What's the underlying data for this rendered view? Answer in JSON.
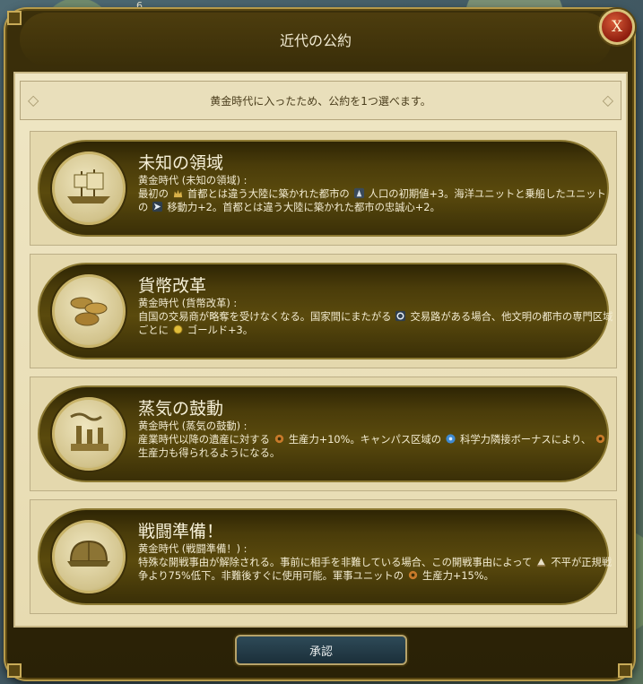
{
  "map": {
    "tile_number": "6"
  },
  "dialog": {
    "title": "近代の公約",
    "close_label": "X",
    "banner": "黄金時代に入ったため、公約を1つ選べます。",
    "accept_label": "承認"
  },
  "cards": [
    {
      "title": "未知の領域",
      "era": "黄金時代 (未知の領域) :",
      "parts": [
        "最初の",
        "首都とは違う大陸に築かれた都市の",
        "人口の初期値+3。海洋ユニットと乗船したユニットの",
        "移動力+2。首都とは違う大陸に築かれた都市の忠誠心+2。"
      ],
      "icons": [
        "capital-icon",
        "citizen-icon",
        "movement-icon"
      ],
      "medal": "ship-icon"
    },
    {
      "title": "貨幣改革",
      "era": "黄金時代 (貨幣改革) :",
      "parts": [
        "自国の交易商が略奪を受けなくなる。国家間にまたがる",
        "交易路がある場合、他文明の都市の専門区域ごとに",
        "ゴールド+3。"
      ],
      "icons": [
        "trade-route-icon",
        "gold-icon"
      ],
      "medal": "coins-icon"
    },
    {
      "title": "蒸気の鼓動",
      "era": "黄金時代 (蒸気の鼓動) :",
      "parts": [
        "産業時代以降の遺産に対する",
        "生産力+10%。キャンパス区域の",
        "科学力隣接ボーナスにより、",
        "生産力も得られるようになる。"
      ],
      "icons": [
        "production-icon",
        "science-icon",
        "production-icon"
      ],
      "medal": "factory-icon"
    },
    {
      "title": "戦闘準備！",
      "era": "黄金時代 (戦闘準備！) :",
      "parts": [
        "特殊な開戦事由が解除される。事前に相手を非難している場合、この開戦事由によって",
        "不平が正規戦争より75%低下。非難後すぐに使用可能。軍事ユニットの",
        "生産力+15%。"
      ],
      "icons": [
        "grievance-icon",
        "production-icon"
      ],
      "medal": "helmet-icon"
    }
  ],
  "colors": {
    "frame": "#3b2f0a",
    "parchment": "#efe6c4",
    "card": "#4a3c0a",
    "gold_trim": "#b69a4a",
    "close_red": "#b8351c",
    "accept_teal": "#2e4a58"
  }
}
